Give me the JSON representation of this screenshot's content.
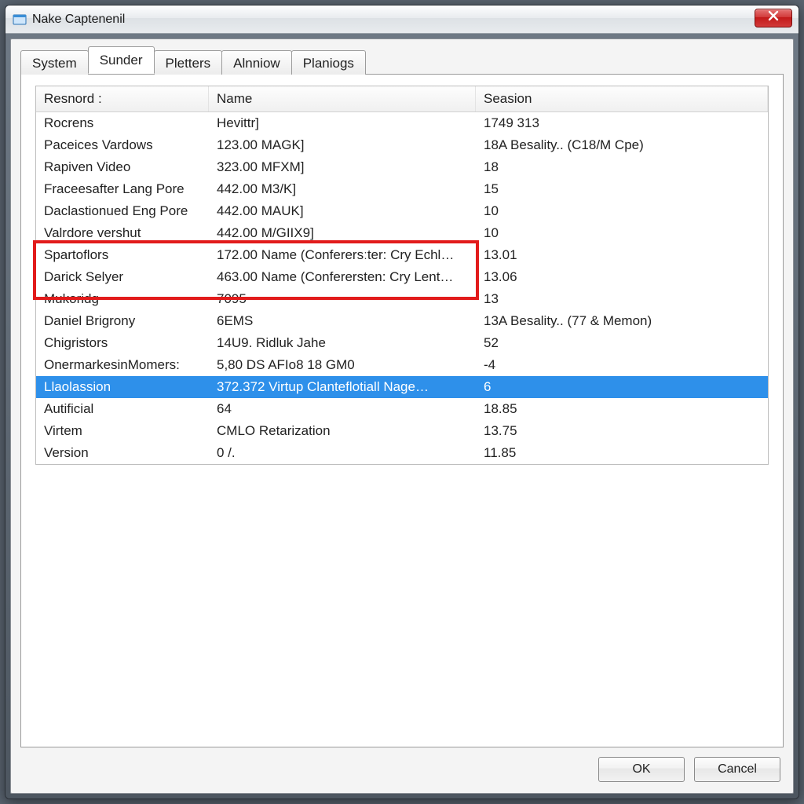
{
  "window": {
    "title": "Nake Captenenil"
  },
  "tabs": [
    {
      "label": "System"
    },
    {
      "label": "Sunder"
    },
    {
      "label": "Pletters"
    },
    {
      "label": "Alnniow"
    },
    {
      "label": "Planiogs"
    }
  ],
  "active_tab_index": 1,
  "listview": {
    "headers": [
      "Resnord :",
      "Name",
      "Seasion"
    ],
    "rows": [
      {
        "c0": "Rocrens",
        "c1": "Hevittr]",
        "c2": "1749 313"
      },
      {
        "c0": "Paceices Vardows",
        "c1": "123.00 MAGK]",
        "c2": "18A Besality.. (C18/M Cpe)"
      },
      {
        "c0": "Rapiven Video",
        "c1": "323.00 MFXM]",
        "c2": "18"
      },
      {
        "c0": "Fraceesafter Lang Pore",
        "c1": "442.00 M3/K]",
        "c2": "15"
      },
      {
        "c0": "Daclastionued Eng Pore",
        "c1": "442.00 MAUK]",
        "c2": "10"
      },
      {
        "c0": "Valrdore vershut",
        "c1": "442.00 M/GIIX9]",
        "c2": "10"
      },
      {
        "c0": "Spartoflors",
        "c1": "172.00 Name (Conferersːter: Cry Echl…",
        "c2": "13.01"
      },
      {
        "c0": "Darick Selyer",
        "c1": "463.00 Name (Conferersten: Cry Lent…",
        "c2": "13.06"
      },
      {
        "c0": "Mukoridg",
        "c1": "7095",
        "c2": "13"
      },
      {
        "c0": "Daniel Brigrony",
        "c1": "6EMS",
        "c2": "13A Besality.. (77 & Memon)"
      },
      {
        "c0": "Chigristors",
        "c1": "14U9. Ridluk Jahe",
        "c2": "52"
      },
      {
        "c0": "OnermarkesinMomers:",
        "c1": "5,80 DS AFIo8 18 GM0",
        "c2": "-4"
      },
      {
        "c0": "Llaolassion",
        "c1": "372.372 Virtup Clanteflotiall Nage…",
        "c2": "6"
      },
      {
        "c0": "Autificial",
        "c1": "64",
        "c2": "18.85"
      },
      {
        "c0": "Virtem",
        "c1": "CMLO Retarization",
        "c2": "13.75"
      },
      {
        "c0": "Version",
        "c1": "0 /.",
        "c2": "11.85"
      }
    ],
    "selected_index": 12
  },
  "buttons": {
    "ok": "OK",
    "cancel": "Cancel"
  },
  "colors": {
    "selection": "#2e90ea",
    "highlight_border": "#e21b1b"
  }
}
